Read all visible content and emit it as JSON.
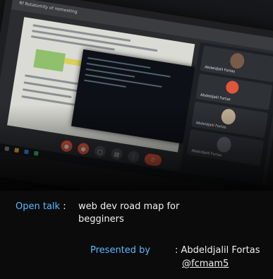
{
  "screen": {
    "topbar_text": "Rf Rotatomity of nemeeting",
    "participants": [
      {
        "name": "Abdeldjalil Fortas"
      },
      {
        "name": "Abdeldjalil Fortas"
      },
      {
        "name": "Abdeldjalil Fortas"
      },
      {
        "name": "Abdeldjalil Fortas"
      }
    ],
    "colors": {
      "accent": "#e0563b",
      "doc_green": "#8fc06b"
    }
  },
  "caption": {
    "open_talk_label": "Open talk",
    "colon": ":",
    "title_line1": "web dev road map for",
    "title_line2": "begginers",
    "presented_by_label": "Presented by",
    "presenter_name": ": Abdeldjalil Fortas",
    "handle": "@fcmam5"
  }
}
